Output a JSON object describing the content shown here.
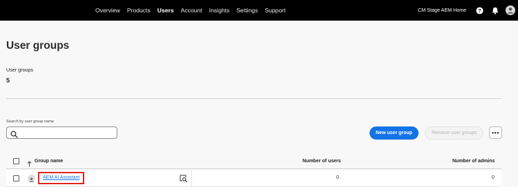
{
  "topnav": {
    "items": [
      {
        "label": "Overview",
        "active": false
      },
      {
        "label": "Products",
        "active": false
      },
      {
        "label": "Users",
        "active": true
      },
      {
        "label": "Account",
        "active": false
      },
      {
        "label": "Insights",
        "active": false
      },
      {
        "label": "Settings",
        "active": false
      },
      {
        "label": "Support",
        "active": false
      }
    ],
    "org_name": "CM Stage AEM Home",
    "icons": [
      "help-icon",
      "bell-icon",
      "avatar-icon"
    ]
  },
  "page": {
    "title": "User groups",
    "stat_label": "User groups",
    "stat_value": "5"
  },
  "search": {
    "label": "Search by user group name",
    "value": "",
    "placeholder": ""
  },
  "actions": {
    "new_group": "New user group",
    "remove_groups": "Remove user groups",
    "more": "•••"
  },
  "table": {
    "columns": [
      "Group name",
      "Number of users",
      "Number of admins"
    ],
    "rows": [
      {
        "name": "AEM AI Assistant",
        "users": "0",
        "admins": "0"
      }
    ]
  },
  "colors": {
    "topbar": "#000000",
    "primary": "#1473e6",
    "highlight": "#e2231a"
  }
}
